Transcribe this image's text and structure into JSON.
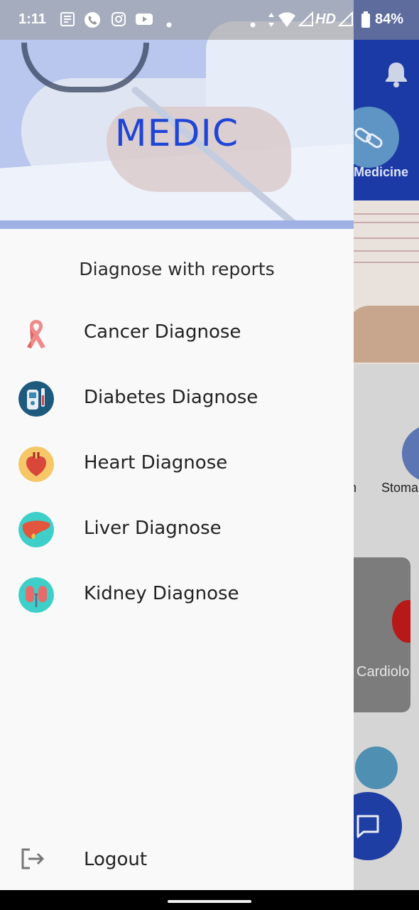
{
  "status_bar": {
    "time": "1:11",
    "network": "HD",
    "battery": "84%"
  },
  "background": {
    "category_label": "r Medicine",
    "category2_label": "Stoma",
    "partial_label": "n",
    "card_label": "Cardiolo"
  },
  "drawer": {
    "brand": "MEDIC",
    "section_title": "Diagnose with reports",
    "items": [
      {
        "label": "Cancer Diagnose",
        "icon": "ribbon-icon"
      },
      {
        "label": "Diabetes Diagnose",
        "icon": "glucometer-icon"
      },
      {
        "label": "Heart Diagnose",
        "icon": "heart-icon"
      },
      {
        "label": "Liver Diagnose",
        "icon": "liver-icon"
      },
      {
        "label": "Kidney Diagnose",
        "icon": "kidney-icon"
      }
    ],
    "logout_label": "Logout"
  },
  "colors": {
    "brand_blue": "#1f45d6",
    "header_blue": "#1c3aa6",
    "drawer_bg": "#f9f9f9"
  }
}
